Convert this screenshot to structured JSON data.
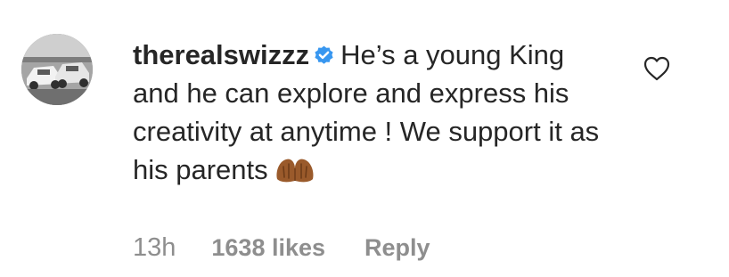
{
  "comment": {
    "username": "therealswizzz",
    "verified_icon": "verified-badge-icon",
    "text": "He’s a young King and he can explore and express his creativity at anytime ! We support it as his parents",
    "emoji_icon": "folded-hands-emoji",
    "avatar_icon": "profile-photo-cars",
    "like_icon": "heart-outline-icon"
  },
  "meta": {
    "time": "13h",
    "likes": "1638 likes",
    "reply": "Reply"
  },
  "colors": {
    "text": "#262626",
    "secondary": "#8e8e8e",
    "verified": "#3897f0",
    "emoji": "#9a5a2b"
  }
}
